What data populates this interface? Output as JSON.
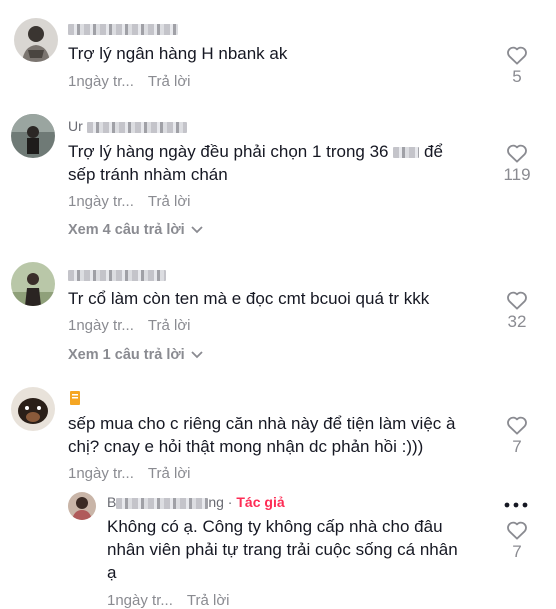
{
  "comments": [
    {
      "username": "",
      "text": "Trợ lý ngân hàng H          nbank ak",
      "time": "1ngày tr...",
      "reply_label": "Trả lời",
      "likes": "5"
    },
    {
      "username": "Ur",
      "text_line1": "Trợ lý hàng ngày đều phải chọn 1 trong 36",
      "text_line1_end": "để",
      "text_line2": "sếp tránh nhàm chán",
      "time": "1ngày tr...",
      "reply_label": "Trả lời",
      "likes": "119",
      "view_replies": "Xem 4 câu trả lời"
    },
    {
      "username": "",
      "text": "Tr cổ làm còn ten mà e đọc cmt bcuoi quá tr kkk",
      "time": "1ngày tr...",
      "reply_label": "Trả lời",
      "likes": "32",
      "view_replies": "Xem 1 câu trả lời"
    },
    {
      "username": "",
      "text_line1": "sếp mua cho c riêng căn nhà này để tiện làm việc à",
      "text_line2": "chị? cnay e hỏi thật mong nhận dc phản hồi :)))",
      "time": "1ngày tr...",
      "reply_label": "Trả lời",
      "likes": "7"
    }
  ],
  "reply": {
    "username_prefix": "B",
    "username_suffix": "ng",
    "separator": " · ",
    "author_label": "Tác giả",
    "text_line1": "Không có ạ. Công ty không cấp nhà cho đâu",
    "text_line2": "nhân viên phải tự trang trải cuộc sống cá nhân",
    "text_line3": "ạ",
    "time": "1ngày tr...",
    "reply_label": "Trả lời",
    "likes": "7"
  },
  "colors": {
    "author": "#fe2c55",
    "muted": "#8a8b91",
    "text": "#161823"
  },
  "icons": [
    "heart-icon",
    "chevron-down-icon",
    "more-icon"
  ]
}
